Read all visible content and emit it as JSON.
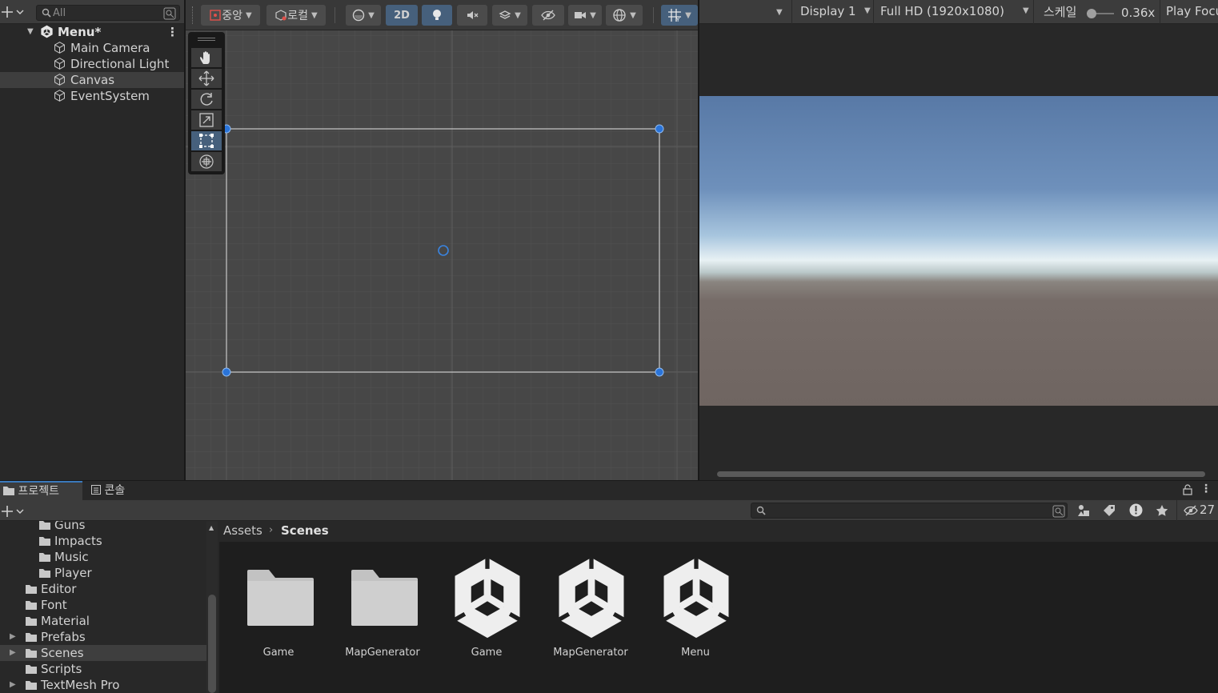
{
  "hierarchy": {
    "search_placeholder": "All",
    "scene_name": "Menu*",
    "items": [
      {
        "label": "Main Camera"
      },
      {
        "label": "Directional Light"
      },
      {
        "label": "Canvas"
      },
      {
        "label": "EventSystem"
      }
    ]
  },
  "scene_toolbar": {
    "pivot_label": "중앙",
    "space_label": "로컬",
    "mode_2d_label": "2D"
  },
  "game_toolbar": {
    "display": "Display 1",
    "resolution": "Full HD (1920x1080)",
    "scale_label": "스케일",
    "scale_value": "0.36x",
    "play_focus": "Play Focu"
  },
  "bottom_panel": {
    "tabs": [
      {
        "label": "프로젝트"
      },
      {
        "label": "콘솔"
      }
    ],
    "hidden_count": "27",
    "breadcrumb": {
      "root": "Assets",
      "current": "Scenes"
    }
  },
  "folder_tree": [
    {
      "label": "Guns"
    },
    {
      "label": "Impacts"
    },
    {
      "label": "Music"
    },
    {
      "label": "Player"
    },
    {
      "label": "Editor"
    },
    {
      "label": "Font"
    },
    {
      "label": "Material"
    },
    {
      "label": "Prefabs"
    },
    {
      "label": "Scenes"
    },
    {
      "label": "Scripts"
    },
    {
      "label": "TextMesh Pro"
    }
  ],
  "assets": [
    {
      "name": "Game",
      "type": "folder"
    },
    {
      "name": "MapGenerator",
      "type": "folder"
    },
    {
      "name": "Game",
      "type": "scene"
    },
    {
      "name": "MapGenerator",
      "type": "scene"
    },
    {
      "name": "Menu",
      "type": "scene"
    }
  ],
  "colors": {
    "accent_blue": "#46607c",
    "selection_handle": "#2a74d9",
    "tab_highlight": "#3a79bb"
  }
}
